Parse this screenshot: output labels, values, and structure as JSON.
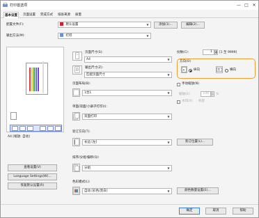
{
  "window": {
    "title": "打印首选项",
    "controls": [
      "—",
      "□",
      "✕"
    ]
  },
  "tabs": [
    {
      "label": "基本设置"
    },
    {
      "label": "页面设置"
    },
    {
      "label": "完成方式"
    },
    {
      "label": "纸张来源"
    },
    {
      "label": "质量"
    }
  ],
  "profile": {
    "label": "配置文件(F):",
    "value": "默认设置",
    "add_label": "添加(1)...",
    "edit_label": "编辑(2)..."
  },
  "output_method": {
    "label": "输出方法(M):",
    "value": "打印"
  },
  "preview": {
    "caption": "A4 [缩放: 自动]",
    "accent": "#4a6fd0"
  },
  "left_buttons": {
    "view_settings": "查看设置(V)",
    "language_settings": "Language Settings(W)...",
    "restore_defaults": "恢复默认设置(R)"
  },
  "page_size": {
    "label": "页面尺寸(S):",
    "value": "A4"
  },
  "output_size": {
    "label": "输出尺寸(Z):",
    "value": "匹配页面尺寸"
  },
  "copies": {
    "label": "份数(C):",
    "value": "1",
    "range": "[1 至 9999]"
  },
  "orientation": {
    "label": "方向(O)",
    "portrait": "纵向",
    "landscape": "横向",
    "selected": "portrait",
    "highlight_color": "#f0a030"
  },
  "page_layout": {
    "label": "页面布局(B):",
    "value": "1合1"
  },
  "manual_scaling": {
    "label": "手动缩放(N)",
    "scale_label": "缩放(E):",
    "scale_value": "100",
    "unit": "%",
    "watermark_label": "水印(X)",
    "watermark_value": "机密"
  },
  "duplex": {
    "label": "单面/双面/小册子打印(I):",
    "value": "双面打印"
  },
  "binding": {
    "label": "装订方向(T):",
    "value": "长边 [左]",
    "button": "装订位置(L)..."
  },
  "collate": {
    "label": "排序/分组/偏移(Q):",
    "value": "分组"
  },
  "color_mode": {
    "label": "色彩模式(L):",
    "value": "自动 [彩色/黑白]",
    "button": "颜色数量设置(E)..."
  },
  "footer": {
    "ok": "确定",
    "cancel": "取消",
    "help": "帮助"
  }
}
